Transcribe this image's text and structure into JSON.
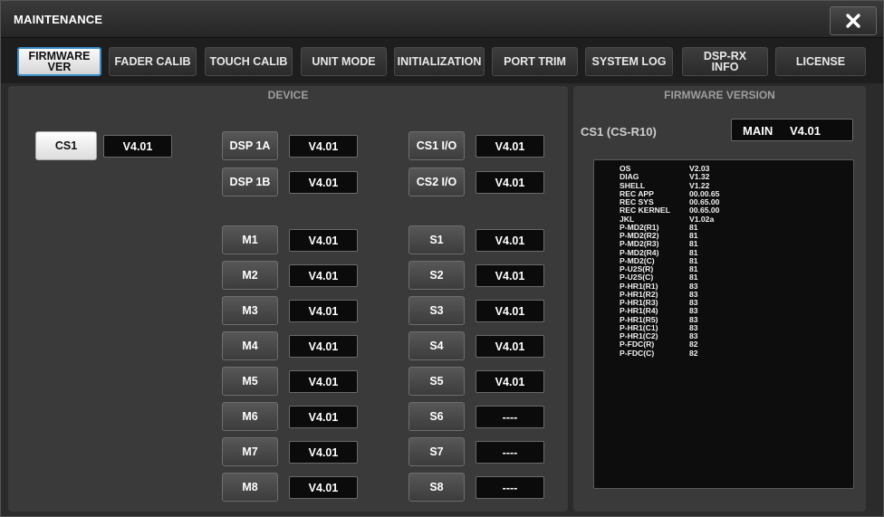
{
  "window": {
    "title": "MAINTENANCE"
  },
  "tabs": [
    {
      "label": "FIRMWARE\nVER",
      "active": true
    },
    {
      "label": "FADER CALIB",
      "active": false
    },
    {
      "label": "TOUCH CALIB",
      "active": false
    },
    {
      "label": "UNIT MODE",
      "active": false
    },
    {
      "label": "INITIALIZATION",
      "active": false
    },
    {
      "label": "PORT TRIM",
      "active": false
    },
    {
      "label": "SYSTEM LOG",
      "active": false
    },
    {
      "label": "DSP-RX\nINFO",
      "active": false
    },
    {
      "label": "LICENSE",
      "active": false
    }
  ],
  "device_panel": {
    "title": "DEVICE",
    "cs1": {
      "label": "CS1",
      "value": "V4.01"
    },
    "dsp": [
      {
        "label": "DSP 1A",
        "value": "V4.01"
      },
      {
        "label": "DSP 1B",
        "value": "V4.01"
      }
    ],
    "io": [
      {
        "label": "CS1 I/O",
        "value": "V4.01"
      },
      {
        "label": "CS2 I/O",
        "value": "V4.01"
      }
    ],
    "m": [
      {
        "label": "M1",
        "value": "V4.01"
      },
      {
        "label": "M2",
        "value": "V4.01"
      },
      {
        "label": "M3",
        "value": "V4.01"
      },
      {
        "label": "M4",
        "value": "V4.01"
      },
      {
        "label": "M5",
        "value": "V4.01"
      },
      {
        "label": "M6",
        "value": "V4.01"
      },
      {
        "label": "M7",
        "value": "V4.01"
      },
      {
        "label": "M8",
        "value": "V4.01"
      }
    ],
    "s": [
      {
        "label": "S1",
        "value": "V4.01"
      },
      {
        "label": "S2",
        "value": "V4.01"
      },
      {
        "label": "S3",
        "value": "V4.01"
      },
      {
        "label": "S4",
        "value": "V4.01"
      },
      {
        "label": "S5",
        "value": "V4.01"
      },
      {
        "label": "S6",
        "value": "----"
      },
      {
        "label": "S7",
        "value": "----"
      },
      {
        "label": "S8",
        "value": "----"
      }
    ]
  },
  "firmware_panel": {
    "title": "FIRMWARE VERSION",
    "device_label": "CS1 (CS-R10)",
    "main_label": "MAIN",
    "main_value": "V4.01",
    "rows": [
      {
        "k": "OS",
        "v": "V2.03"
      },
      {
        "k": "DIAG",
        "v": "V1.32"
      },
      {
        "k": "SHELL",
        "v": "V1.22"
      },
      {
        "k": "REC APP",
        "v": "00.00.65"
      },
      {
        "k": "REC SYS",
        "v": "00.65.00"
      },
      {
        "k": "REC KERNEL",
        "v": "00.65.00"
      },
      {
        "k": "JKL",
        "v": "V1.02a"
      },
      {
        "k": "P-MD2(R1)",
        "v": "81"
      },
      {
        "k": "P-MD2(R2)",
        "v": "81"
      },
      {
        "k": "P-MD2(R3)",
        "v": "81"
      },
      {
        "k": "P-MD2(R4)",
        "v": "81"
      },
      {
        "k": "P-MD2(C)",
        "v": "81"
      },
      {
        "k": "P-U2S(R)",
        "v": "81"
      },
      {
        "k": "P-U2S(C)",
        "v": "81"
      },
      {
        "k": "P-HR1(R1)",
        "v": "83"
      },
      {
        "k": "P-HR1(R2)",
        "v": "83"
      },
      {
        "k": "P-HR1(R3)",
        "v": "83"
      },
      {
        "k": "P-HR1(R4)",
        "v": "83"
      },
      {
        "k": "P-HR1(R5)",
        "v": "83"
      },
      {
        "k": "P-HR1(C1)",
        "v": "83"
      },
      {
        "k": "P-HR1(C2)",
        "v": "83"
      },
      {
        "k": "P-FDC(R)",
        "v": "82"
      },
      {
        "k": "P-FDC(C)",
        "v": "82"
      }
    ]
  },
  "icons": {
    "close": "close-icon"
  }
}
